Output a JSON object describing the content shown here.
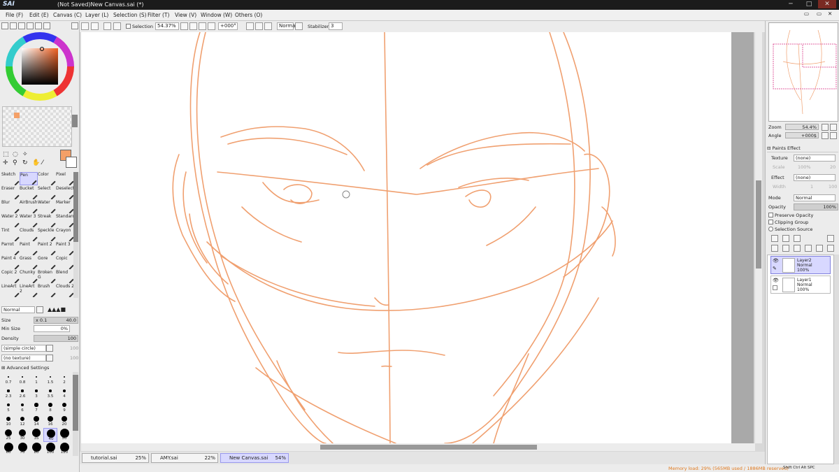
{
  "app": {
    "logo": "SAI",
    "title": "(Not Saved)New Canvas.sai (*)"
  },
  "window_controls": {
    "minimize": "─",
    "maximize": "□",
    "close": "✕"
  },
  "menu": [
    "File (F)",
    "Edit (E)",
    "Canvas (C)",
    "Layer (L)",
    "Selection (S)",
    "Filter (T)",
    "View (V)",
    "Window (W)",
    "Others (O)"
  ],
  "toolbar": {
    "selection_label": "Selection",
    "zoom": "54.37%",
    "angle": "+000°",
    "blend": "Normal",
    "stabilizer_label": "Stabilizer",
    "stabilizer_value": "3"
  },
  "colors": {
    "primary": "#f4a068",
    "line": "#f0a070",
    "accent": "#8080dd"
  },
  "brushes": [
    [
      "Sketch",
      "Pen",
      "Color",
      "Pixel"
    ],
    [
      "Eraser",
      "Bucket",
      "Select",
      "Deselect"
    ],
    [
      "Blur",
      "AirBrush",
      "Water",
      "Marker"
    ],
    [
      "Water 2",
      "Water 3",
      "Streak",
      "Standard"
    ],
    [
      "Tint",
      "Clouds",
      "Speckle",
      "Crayon"
    ],
    [
      "Parrot",
      "Paint",
      "Paint 2",
      "Paint 3"
    ],
    [
      "Paint 4",
      "Grass",
      "Gore",
      "Copic"
    ],
    [
      "Copic 2",
      "Chunky",
      "Broken G",
      "Blend"
    ],
    [
      "LineArt",
      "LineArt 2",
      "Brush",
      "Clouds 2"
    ]
  ],
  "selected_brush": "Pen",
  "tool_props": {
    "blend_mode": "Normal",
    "size_label": "Size",
    "size_mult": "x 0.1",
    "size_value": "40.0",
    "min_size_label": "Min Size",
    "min_size_value": "0%",
    "density_label": "Density",
    "density_value": "100",
    "shape": "(simple circle)",
    "shape_value": "100",
    "texture": "(no texture)",
    "texture_value": "100",
    "advanced": "Advanced Settings"
  },
  "brush_sizes": [
    [
      "0.7",
      "0.8",
      "1",
      "1.5",
      "2"
    ],
    [
      "2.3",
      "2.6",
      "3",
      "3.5",
      "4"
    ],
    [
      "5",
      "6",
      "7",
      "8",
      "9"
    ],
    [
      "10",
      "12",
      "14",
      "16",
      "20"
    ],
    [
      "25",
      "30",
      "35",
      "40",
      "50"
    ],
    [
      "60",
      "70",
      "80",
      "100",
      "120"
    ]
  ],
  "selected_size": "40",
  "navigator": {
    "zoom_label": "Zoom",
    "zoom_value": "54.4%",
    "angle_label": "Angle",
    "angle_value": "+000$"
  },
  "paint_effect": {
    "header": "Paints Effect",
    "texture_label": "Texture",
    "texture_value": "(none)",
    "scale_label": "Scale",
    "scale_value": "100%",
    "scale_value2": "20",
    "effect_label": "Effect",
    "effect_value": "(none)",
    "width_label": "Width",
    "width_value": "1",
    "width_value2": "100"
  },
  "layer_props": {
    "mode_label": "Mode",
    "mode_value": "Normal",
    "opacity_label": "Opacity",
    "opacity_value": "100%",
    "preserve_opacity": "Preserve Opacity",
    "clipping_group": "Clipping Group",
    "selection_source": "Selection Source"
  },
  "layers": [
    {
      "name": "Layer2",
      "mode": "Normal",
      "opacity": "100%",
      "active": true
    },
    {
      "name": "Layer1",
      "mode": "Normal",
      "opacity": "100%",
      "active": false
    }
  ],
  "doc_tabs": [
    {
      "name": "tutorial.sai",
      "zoom": "25%"
    },
    {
      "name": "AMY.sai",
      "zoom": "22%"
    },
    {
      "name": "New Canvas.sai",
      "zoom": "54%",
      "active": true
    }
  ],
  "status": {
    "memory": "Memory load: 29% (565MB used / 1886MB reserved)",
    "keys": "Shift Ctrl Alt SPC"
  }
}
